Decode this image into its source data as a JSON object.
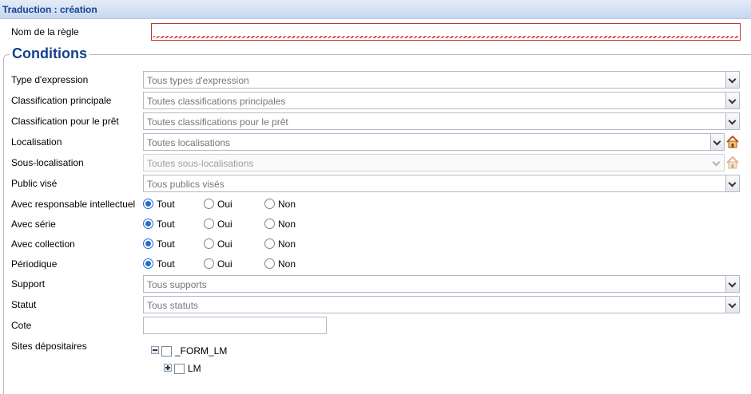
{
  "window": {
    "title": "Traduction : création"
  },
  "rule": {
    "label": "Nom de la règle",
    "value": ""
  },
  "conditions": {
    "legend": "Conditions",
    "expression_type": {
      "label": "Type d'expression",
      "value": "Tous types d'expression"
    },
    "main_classification": {
      "label": "Classification principale",
      "value": "Toutes classifications principales"
    },
    "loan_classification": {
      "label": "Classification pour le prêt",
      "value": "Toutes classifications pour le prêt"
    },
    "location": {
      "label": "Localisation",
      "value": "Toutes localisations",
      "icon": "home-icon"
    },
    "sub_location": {
      "label": "Sous-localisation",
      "value": "Toutes sous-localisations",
      "icon": "home-icon",
      "disabled": true
    },
    "audience": {
      "label": "Public visé",
      "value": "Tous publics visés"
    },
    "intellectual_resp": {
      "label": "Avec responsable intellectuel",
      "options": [
        "Tout",
        "Oui",
        "Non"
      ],
      "selected": "Tout"
    },
    "series": {
      "label": "Avec série",
      "options": [
        "Tout",
        "Oui",
        "Non"
      ],
      "selected": "Tout"
    },
    "collection": {
      "label": "Avec collection",
      "options": [
        "Tout",
        "Oui",
        "Non"
      ],
      "selected": "Tout"
    },
    "periodical": {
      "label": "Périodique",
      "options": [
        "Tout",
        "Oui",
        "Non"
      ],
      "selected": "Tout"
    },
    "support": {
      "label": "Support",
      "value": "Tous supports"
    },
    "status": {
      "label": "Statut",
      "value": "Tous statuts"
    },
    "cote": {
      "label": "Cote",
      "value": ""
    },
    "sites": {
      "label": "Sites dépositaires",
      "tree": [
        {
          "label": "_FORM_LM",
          "expanded": true,
          "checked": false
        },
        {
          "label": "LM",
          "expanded": false,
          "checked": false
        }
      ]
    }
  },
  "colors": {
    "title": "#15428b",
    "radio": "#1f6fd0",
    "error_border": "#c0392b"
  }
}
